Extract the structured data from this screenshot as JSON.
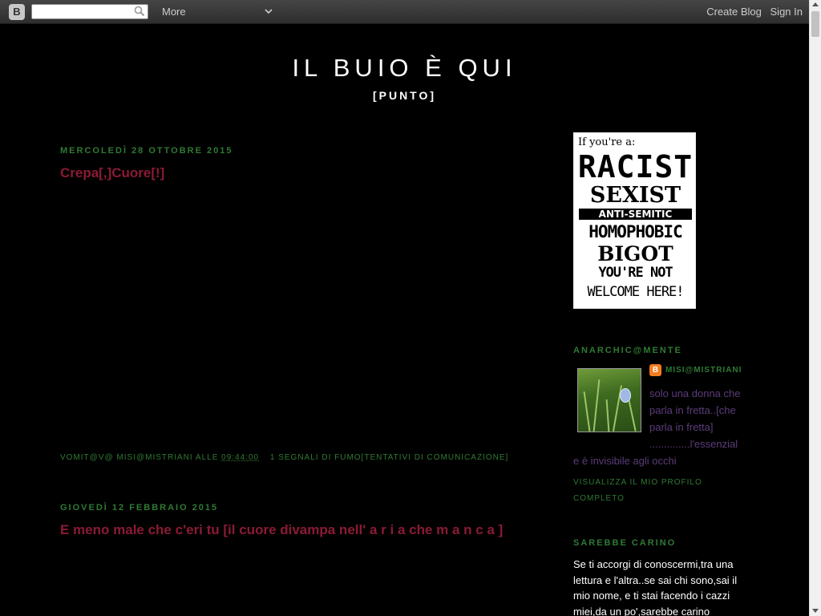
{
  "navbar": {
    "logo_glyph": "B",
    "search_value": "",
    "search_placeholder": "",
    "more_label": "More",
    "create_blog_label": "Create Blog",
    "sign_in_label": "Sign In"
  },
  "header": {
    "title": "IL BUIO È QUI",
    "description": "[PUNTO]"
  },
  "posts": [
    {
      "date": "MERCOLEDÌ 28 OTTOBRE 2015",
      "title": "Crepa[,]Cuore[!]",
      "footer_author_prefix": "VOMIT@V@ MISI@MISTRIANI ALLE",
      "footer_time": "09:44:00",
      "footer_comments": "1 SEGNALI DI FUMO[TENTATIVI DI COMUNICAZIONE]"
    },
    {
      "date": "GIOVEDÌ 12 FEBBRAIO 2015",
      "title": "E meno male che c'eri tu [il cuore divampa nell' a r i a che m a n c a ]"
    }
  ],
  "sidebar": {
    "poster_lines": [
      "If you're a:",
      "RACIST",
      "SEXIST",
      "ANTI-SEMITIC",
      "HOMOPHOBIC",
      "BIGOT",
      "YOU'RE NOT",
      "WELCOME HERE!"
    ],
    "profile_heading": "ANARCHIC@MENTE",
    "profile_name": "MISI@MISTRIANI",
    "profile_about_lines": [
      "solo una donna che",
      "parla in fretta..[che",
      "parla in fretta]",
      "..............l'essenzial",
      "e è invisibile agli occhi"
    ],
    "profile_link_lines": [
      "VISUALIZZA IL MIO PROFILO",
      "COMPLETO"
    ],
    "widget_heading": "SAREBBE CARINO",
    "widget_text": "Se ti accorgi di conoscermi,tra una lettura e l'altra..se sai chi sono,sai il mio nome, e ti stai facendo i cazzi miei,da un po',sarebbe carino"
  },
  "colors": {
    "background": "#000000",
    "date_green": "#2f7a33",
    "title_red": "#8b1a35",
    "about_purple": "#5b3c7a"
  }
}
